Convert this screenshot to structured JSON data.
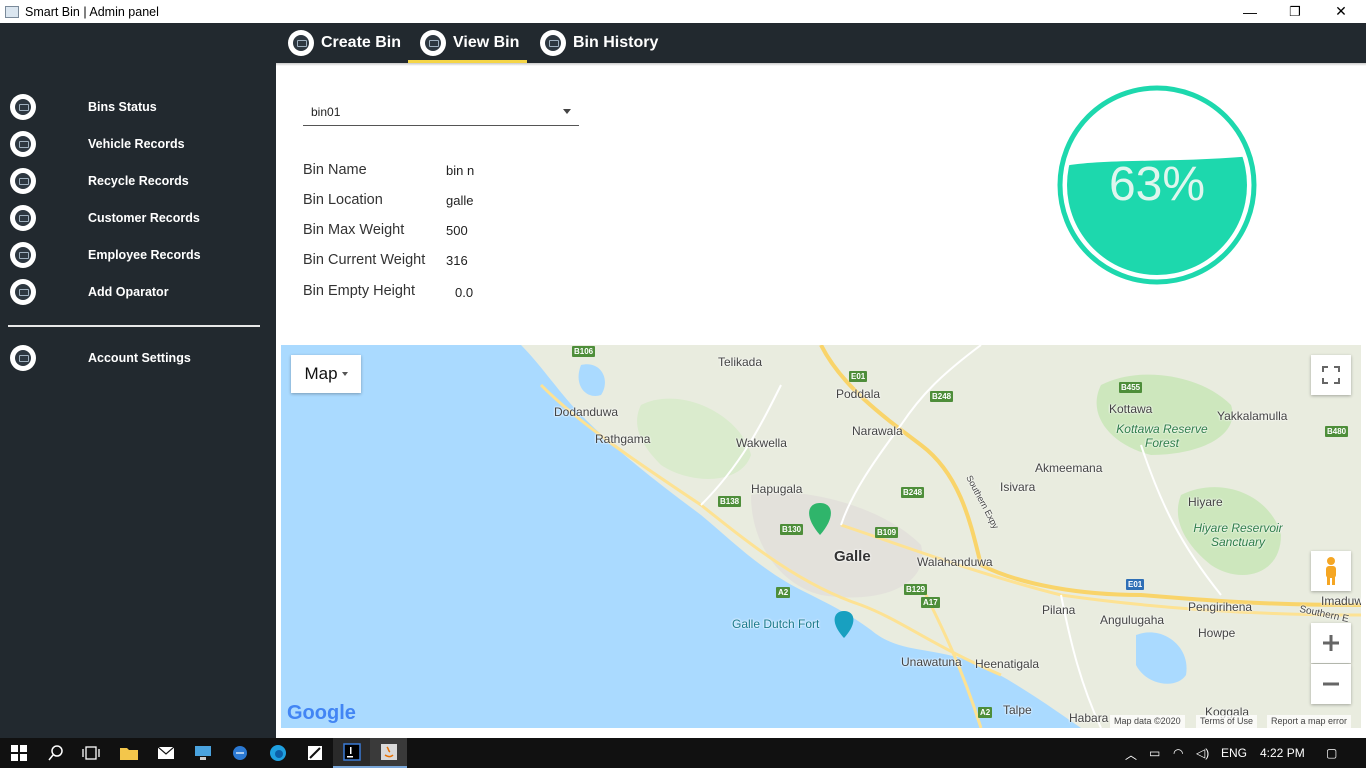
{
  "window": {
    "title": "Smart Bin | Admin panel",
    "minimize": "—",
    "restore": "❐",
    "close": "✕"
  },
  "sidebar": {
    "items": [
      {
        "label": "Bins Status"
      },
      {
        "label": "Vehicle Records"
      },
      {
        "label": "Recycle Records"
      },
      {
        "label": "Customer Records"
      },
      {
        "label": "Employee Records"
      },
      {
        "label": "Add Oparator"
      },
      {
        "label": "Account Settings"
      }
    ]
  },
  "topnav": {
    "tabs": [
      {
        "label": "Create Bin"
      },
      {
        "label": "View Bin",
        "active": true
      },
      {
        "label": "Bin History"
      }
    ],
    "accent": "#f5d547"
  },
  "bin": {
    "selected": "bin01",
    "fields": [
      {
        "label": "Bin Name",
        "value": "bin n"
      },
      {
        "label": "Bin Location",
        "value": "galle"
      },
      {
        "label": "Bin Max Weight",
        "value": "500"
      },
      {
        "label": "Bin Current Weight",
        "value": "316"
      },
      {
        "label": "Bin Empty Height",
        "value": "0.0"
      }
    ]
  },
  "gauge": {
    "percent_text": "63%",
    "fill_fraction": 0.63,
    "color": "#1dd8ad"
  },
  "map": {
    "type_button": "Map",
    "places": [
      "Telikada",
      "Poddala",
      "Dodanduwa",
      "Rathgama",
      "Wakwella",
      "Narawala",
      "Kottawa",
      "Yakkalamulla",
      "Kottawa Reserve Forest",
      "Akmeemana",
      "Isivara",
      "Hapugala",
      "Hiyare",
      "Galle",
      "Walahanduwa",
      "Hiyare Reservoir Sanctuary",
      "Imaduw",
      "Pengirihena",
      "Pilana",
      "Angulugaha",
      "Howpe",
      "Galle Dutch Fort",
      "Unawatuna",
      "Heenatigala",
      "Talpe",
      "Habara",
      "Koggala",
      "Southern Expy",
      "Southern E"
    ],
    "roads": [
      "B106",
      "E01",
      "B248",
      "B455",
      "B480",
      "B138",
      "B248",
      "B130",
      "B109",
      "B129",
      "A17",
      "A2",
      "E01",
      "A2"
    ],
    "google": "Google",
    "footer": {
      "data": "Map data ©2020",
      "terms": "Terms of Use",
      "report": "Report a map error"
    }
  },
  "taskbar": {
    "lang": "ENG",
    "time": "4:22 PM"
  }
}
